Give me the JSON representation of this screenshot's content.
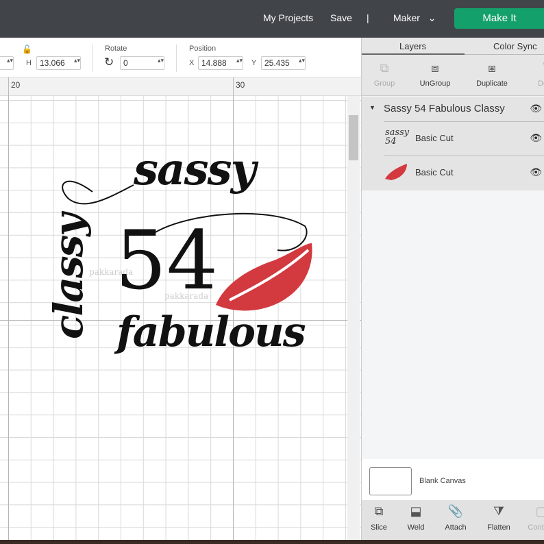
{
  "topbar": {
    "my_projects": "My Projects",
    "save": "Save",
    "divider": "|",
    "machine": "Maker",
    "make_it": "Make It"
  },
  "toolbar": {
    "h_label": "H",
    "h_value": "13.066",
    "rotate_label": "Rotate",
    "rotate_value": "0",
    "position_label": "Position",
    "x_label": "X",
    "x_value": "14.888",
    "y_label": "Y",
    "y_value": "25.435"
  },
  "ruler": {
    "ticks": [
      "20",
      "30"
    ]
  },
  "artwork": {
    "word1": "sassy",
    "number": "54",
    "word2": "fabulous",
    "word3": "classy",
    "watermark": "pakkarada",
    "lips_color": "#d23a3f"
  },
  "panel": {
    "tabs": [
      "Layers",
      "Color Sync"
    ],
    "actions": [
      "Group",
      "UnGroup",
      "Duplicate",
      "Delete"
    ],
    "group_name": "Sassy 54 Fabulous Classy",
    "layers": [
      {
        "label": "Basic Cut",
        "thumb": "text-design"
      },
      {
        "label": "Basic Cut",
        "thumb": "lips"
      }
    ],
    "blank_canvas": "Blank Canvas",
    "bottom_actions": [
      "Slice",
      "Weld",
      "Attach",
      "Flatten",
      "Contour"
    ]
  }
}
